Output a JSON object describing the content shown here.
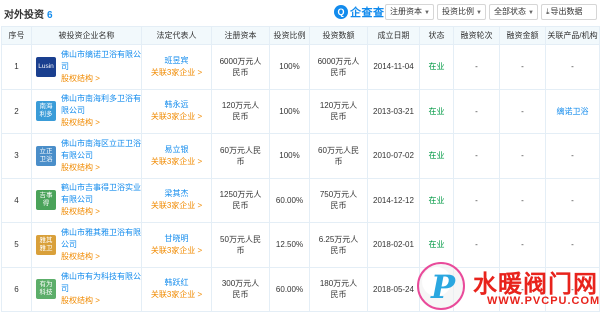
{
  "header": {
    "title": "对外投资",
    "count": "6",
    "brand_mark": "Q",
    "brand_text": "企查查",
    "filters": [
      {
        "label": "注册资本"
      },
      {
        "label": "投资比例"
      },
      {
        "label": "全部状态"
      }
    ],
    "export_label": "导出数据"
  },
  "columns": [
    "序号",
    "被投资企业名称",
    "法定代表人",
    "注册资本",
    "投资比例",
    "投资数额",
    "成立日期",
    "状态",
    "融资轮次",
    "融资金额",
    "关联产品/机构"
  ],
  "rows": [
    {
      "index": "1",
      "logo_text": "Lusin",
      "logo_color": "#1a3f8f",
      "company": "佛山市缡诺卫浴有限公司",
      "equity": "股权结构 >",
      "person": "班昱宾",
      "person_rel": "关联3家企业 >",
      "capital": "6000万元人民币",
      "ratio": "100%",
      "amount": "6000万元人民币",
      "date": "2014-11-04",
      "status": "在业",
      "round": "-",
      "funding": "-",
      "related": "-"
    },
    {
      "index": "2",
      "logo_text": "南海 利多",
      "logo_color": "#3a9cd8",
      "company": "佛山市南海利多卫浴有限公司",
      "equity": "股权结构 >",
      "person": "韩永远",
      "person_rel": "关联3家企业 >",
      "capital": "120万元人民币",
      "ratio": "100%",
      "amount": "120万元人民币",
      "date": "2013-03-21",
      "status": "在业",
      "round": "-",
      "funding": "-",
      "related": "缡诺卫浴"
    },
    {
      "index": "3",
      "logo_text": "立正 卫浴",
      "logo_color": "#4a8ec9",
      "company": "佛山市南海区立正卫浴有限公司",
      "equity": "股权结构 >",
      "person": "易立银",
      "person_rel": "关联3家企业 >",
      "capital": "60万元人民币",
      "ratio": "100%",
      "amount": "60万元人民币",
      "date": "2010-07-02",
      "status": "在业",
      "round": "-",
      "funding": "-",
      "related": "-"
    },
    {
      "index": "4",
      "logo_text": "吉事 得",
      "logo_color": "#4aa35a",
      "company": "鹤山市吉事得卫浴实业有限公司",
      "equity": "股权结构 >",
      "person": "梁其杰",
      "person_rel": "关联3家企业 >",
      "capital": "1250万元人民币",
      "ratio": "60.00%",
      "amount": "750万元人民币",
      "date": "2014-12-12",
      "status": "在业",
      "round": "-",
      "funding": "-",
      "related": "-"
    },
    {
      "index": "5",
      "logo_text": "雅其 雅卫",
      "logo_color": "#d9a03a",
      "company": "佛山市雅其雅卫浴有限公司",
      "equity": "股权结构 >",
      "person": "甘晓明",
      "person_rel": "关联3家企业 >",
      "capital": "50万元人民币",
      "ratio": "12.50%",
      "amount": "6.25万元人民币",
      "date": "2018-02-01",
      "status": "在业",
      "round": "-",
      "funding": "-",
      "related": "-"
    },
    {
      "index": "6",
      "logo_text": "有为 科技",
      "logo_color": "#5cae6a",
      "company": "佛山市有为科技有限公司",
      "equity": "股权结构 >",
      "person": "韩跃红",
      "person_rel": "关联3家企业 >",
      "capital": "300万元人民币",
      "ratio": "60.00%",
      "amount": "180万元人民币",
      "date": "2018-05-24",
      "status": "在业",
      "round": "-",
      "funding": "-",
      "related": "-"
    }
  ],
  "watermark": {
    "logo_letter": "P",
    "cn": "水暖阀门网",
    "url": "WWW.PVCPU.COM"
  }
}
